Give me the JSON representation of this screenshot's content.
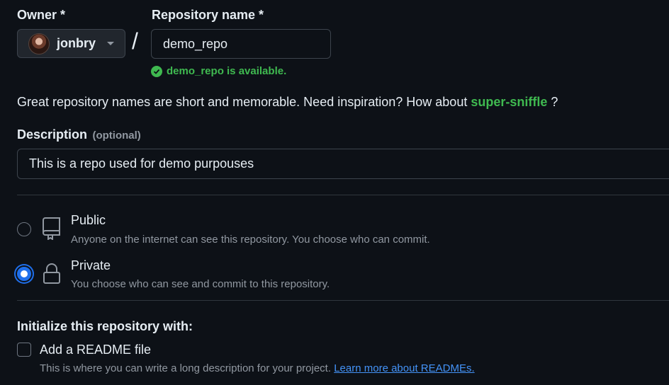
{
  "owner": {
    "label": "Owner *",
    "selected": "jonbry"
  },
  "repo_name": {
    "label": "Repository name *",
    "value": "demo_repo",
    "availability": "demo_repo is available."
  },
  "separator": "/",
  "hint": {
    "text": "Great repository names are short and memorable. Need inspiration? How about",
    "suggestion": "super-sniffle",
    "suffix": "?"
  },
  "description": {
    "label": "Description",
    "optional": "(optional)",
    "value": "This is a repo used for demo purpouses"
  },
  "visibility": {
    "selected": "private",
    "options": [
      {
        "key": "public",
        "title": "Public",
        "subtitle": "Anyone on the internet can see this repository. You choose who can commit.",
        "icon": "repo-icon"
      },
      {
        "key": "private",
        "title": "Private",
        "subtitle": "You choose who can see and commit to this repository.",
        "icon": "lock-icon"
      }
    ]
  },
  "initialize": {
    "label": "Initialize this repository with:",
    "readme": {
      "title": "Add a README file",
      "subtitle": "This is where you can write a long description for your project.",
      "link": "Learn more about READMEs.",
      "checked": false
    }
  },
  "colors": {
    "background": "#0d1117",
    "success": "#3fb950",
    "accent": "#1f6feb",
    "link": "#4493f8",
    "muted": "#9198a1"
  }
}
